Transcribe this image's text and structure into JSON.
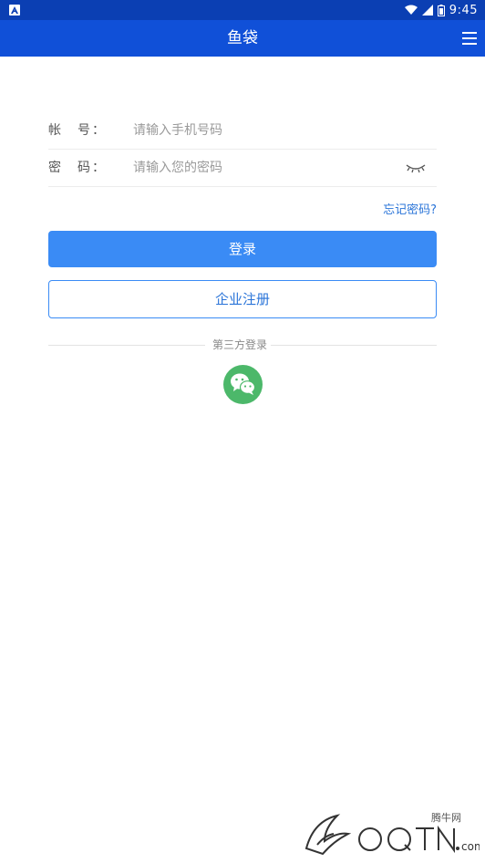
{
  "status_bar": {
    "time": "9:45"
  },
  "app_bar": {
    "title": "鱼袋"
  },
  "login_form": {
    "account": {
      "label": "帐　号：",
      "placeholder": "请输入手机号码",
      "value": ""
    },
    "password": {
      "label": "密　码：",
      "placeholder": "请输入您的密码",
      "value": ""
    },
    "forgot_password": "忘记密码?",
    "login_button": "登录",
    "register_button": "企业注册"
  },
  "third_party": {
    "label": "第三方登录",
    "providers": [
      "wechat"
    ]
  },
  "watermark": {
    "site_cn": "腾牛网"
  },
  "colors": {
    "status_bar": "#0b3fb3",
    "app_bar": "#1050d8",
    "primary_button": "#3a8bf5",
    "link": "#2a74d8",
    "wechat": "#4cb86a"
  },
  "icons": {
    "menu": "hamburger-menu-icon",
    "password_toggle": "eye-closed-icon",
    "wechat": "wechat-icon"
  }
}
